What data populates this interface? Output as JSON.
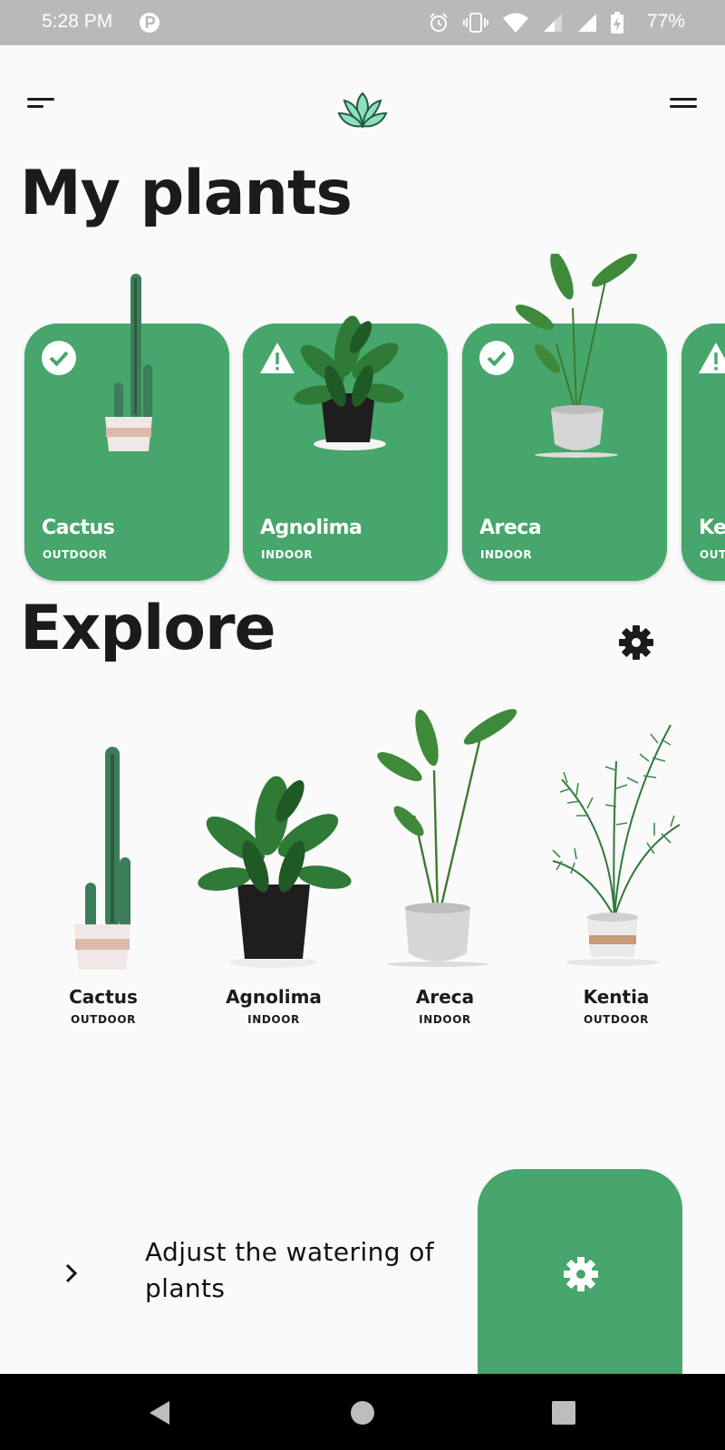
{
  "status_bar": {
    "time": "5:28 PM",
    "battery": "77%",
    "icons": [
      "parking-icon",
      "alarm-icon",
      "vibrate-icon",
      "wifi-icon",
      "signal-icon",
      "signal-icon",
      "battery-charging-icon"
    ]
  },
  "header": {
    "menu_left_icon": "menu-short-icon",
    "logo_icon": "lotus-icon",
    "menu_right_icon": "menu-icon"
  },
  "my_plants": {
    "title": "My plants",
    "cards": [
      {
        "name": "Cactus",
        "location": "OUTDOOR",
        "status": "check"
      },
      {
        "name": "Agnolima",
        "location": "INDOOR",
        "status": "warning"
      },
      {
        "name": "Areca",
        "location": "INDOOR",
        "status": "check"
      },
      {
        "name": "Kentia",
        "location": "OUTDOOR",
        "status": "warning"
      }
    ]
  },
  "explore": {
    "title": "Explore",
    "settings_icon": "gear-icon",
    "items": [
      {
        "name": "Cactus",
        "location": "OUTDOOR"
      },
      {
        "name": "Agnolima",
        "location": "INDOOR"
      },
      {
        "name": "Areca",
        "location": "INDOOR"
      },
      {
        "name": "Kentia",
        "location": "OUTDOOR"
      }
    ]
  },
  "watering": {
    "text": "Adjust the watering of plants",
    "chevron_icon": "chevron-right-icon",
    "settings_icon": "gear-icon"
  },
  "nav": {
    "back_icon": "back-triangle-icon",
    "home_icon": "home-circle-icon",
    "recents_icon": "recents-square-icon"
  },
  "colors": {
    "accent": "#46a66c",
    "status_bar": "#b9b9b9",
    "background": "#fafafa",
    "text": "#1b1b1b"
  }
}
